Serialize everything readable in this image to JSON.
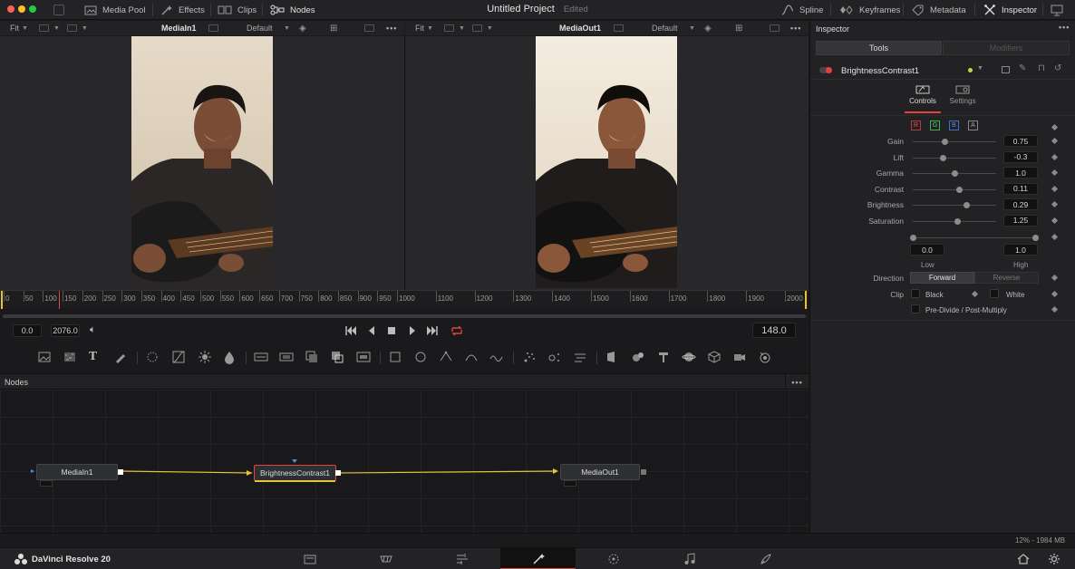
{
  "topbar": {
    "media_pool": "Media Pool",
    "effects": "Effects",
    "clips": "Clips",
    "nodes": "Nodes",
    "project_title": "Untitled Project",
    "project_status": "Edited",
    "spline": "Spline",
    "keyframes": "Keyframes",
    "metadata": "Metadata",
    "inspector": "Inspector"
  },
  "viewer_left": {
    "fit": "Fit",
    "name": "MediaIn1",
    "mode": "Default"
  },
  "viewer_right": {
    "fit": "Fit",
    "name": "MediaOut1",
    "mode": "Default"
  },
  "ruler": {
    "labels": [
      "0",
      "50",
      "100",
      "150",
      "200",
      "250",
      "300",
      "350",
      "400",
      "450",
      "500",
      "550",
      "600",
      "650",
      "700",
      "750",
      "800",
      "850",
      "900",
      "950",
      "1000",
      "1100",
      "1200",
      "1300",
      "1400",
      "1500",
      "1600",
      "1700",
      "1800",
      "1900",
      "2000"
    ]
  },
  "transport": {
    "start": "0.0",
    "end": "2076.0",
    "current": "148.0"
  },
  "nodes_panel": {
    "title": "Nodes",
    "node_in": "MediaIn1",
    "node_bc": "BrightnessContrast1",
    "node_out": "MediaOut1"
  },
  "inspector": {
    "title": "Inspector",
    "tab_tools": "Tools",
    "tab_modifiers": "Modifiers",
    "tool_name": "BrightnessContrast1",
    "subtab_controls": "Controls",
    "subtab_settings": "Settings",
    "channels": [
      "R",
      "G",
      "B",
      "A"
    ],
    "params": [
      {
        "label": "Gain",
        "value": "0.75",
        "pos": 0.38
      },
      {
        "label": "Lift",
        "value": "-0.3",
        "pos": 0.36
      },
      {
        "label": "Gamma",
        "value": "1.0",
        "pos": 0.5
      },
      {
        "label": "Contrast",
        "value": "0.11",
        "pos": 0.55
      },
      {
        "label": "Brightness",
        "value": "0.29",
        "pos": 0.64
      },
      {
        "label": "Saturation",
        "value": "1.25",
        "pos": 0.53
      }
    ],
    "range_low_value": "0.0",
    "range_high_value": "1.0",
    "range_low_label": "Low",
    "range_high_label": "High",
    "direction_label": "Direction",
    "direction_forward": "Forward",
    "direction_reverse": "Reverse",
    "clip_label": "Clip",
    "clip_black": "Black",
    "clip_white": "White",
    "predivide": "Pre-Divide / Post-Multiply"
  },
  "status": {
    "memory": "12% - 1984 MB"
  },
  "bottombar": {
    "app_name": "DaVinci Resolve 20"
  },
  "colors": {
    "accent_red": "#e0443a",
    "node_link": "#e8c23a",
    "selected_page": "#e0443a"
  }
}
